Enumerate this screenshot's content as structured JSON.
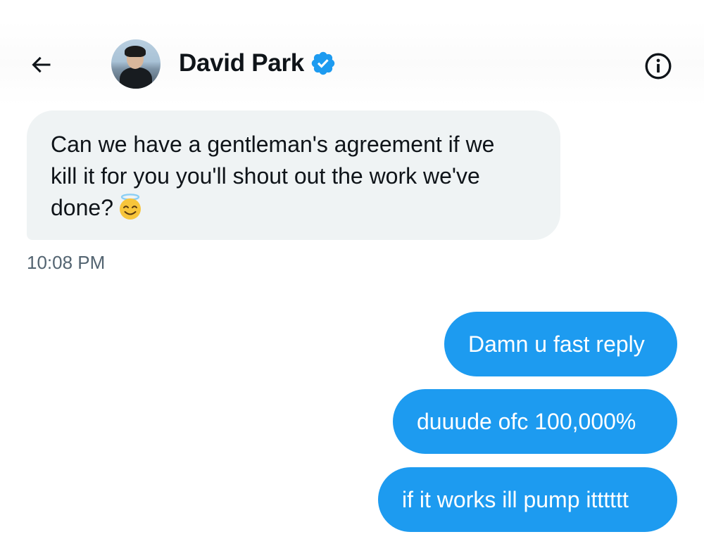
{
  "header": {
    "contact_name": "David Park",
    "verified": true,
    "back_icon": "arrow-left-icon",
    "info_icon": "info-circle-icon",
    "verified_icon": "verified-badge-icon",
    "verified_color": "#1d9bf0"
  },
  "messages": {
    "incoming": [
      {
        "text": "Can we have a gentleman's agreement if we\nkill it for you you'll shout out the work we've\ndone?",
        "emoji": "smiling-face-with-halo",
        "timestamp": "10:08 PM"
      }
    ],
    "outgoing": [
      {
        "text": "Damn u fast reply"
      },
      {
        "text": "duuude ofc 100,000%"
      },
      {
        "text": "if it works ill pump itttttt"
      }
    ]
  },
  "colors": {
    "outgoing_bubble": "#1d9bf0",
    "incoming_bubble": "#eff3f4",
    "timestamp_text": "#536471"
  }
}
